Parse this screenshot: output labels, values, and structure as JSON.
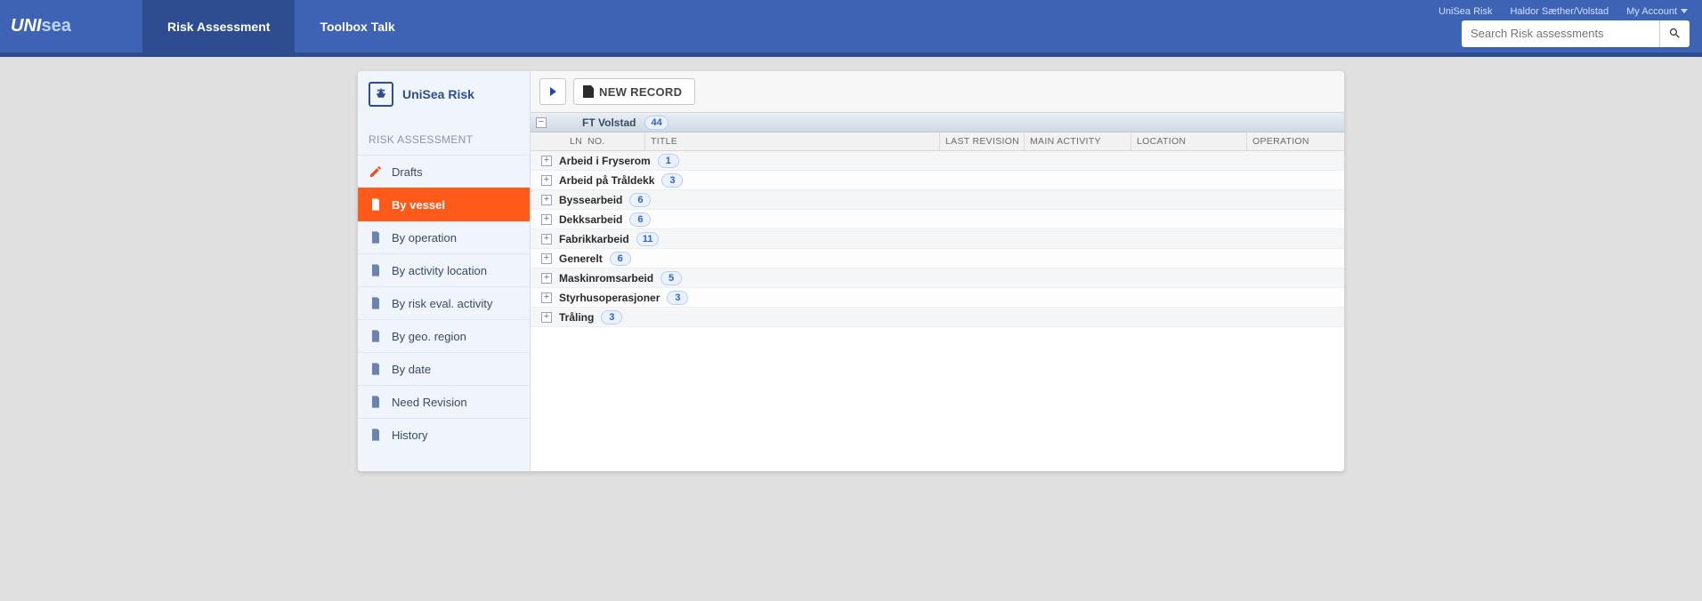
{
  "brand": {
    "a": "UNI",
    "b": "sea"
  },
  "topnav": {
    "tabs": [
      {
        "label": "Risk Assessment",
        "active": true
      },
      {
        "label": "Toolbox Talk",
        "active": false
      }
    ],
    "links": {
      "app": "UniSea Risk",
      "user": "Haldor Sæther/Volstad",
      "account": "My Account"
    },
    "search_placeholder": "Search Risk assessments"
  },
  "sidebar": {
    "module": "UniSea Risk",
    "section": "RISK ASSESSMENT",
    "items": [
      {
        "label": "Drafts",
        "active": false,
        "icon": "edit"
      },
      {
        "label": "By vessel",
        "active": true,
        "icon": "doc"
      },
      {
        "label": "By operation",
        "active": false,
        "icon": "doc"
      },
      {
        "label": "By activity location",
        "active": false,
        "icon": "doc"
      },
      {
        "label": "By risk eval. activity",
        "active": false,
        "icon": "doc"
      },
      {
        "label": "By geo. region",
        "active": false,
        "icon": "doc"
      },
      {
        "label": "By date",
        "active": false,
        "icon": "doc"
      },
      {
        "label": "Need Revision",
        "active": false,
        "icon": "doc"
      },
      {
        "label": "History",
        "active": false,
        "icon": "doc"
      }
    ]
  },
  "toolbar": {
    "new_record": "NEW RECORD"
  },
  "group": {
    "name": "FT Volstad",
    "count": "44"
  },
  "columns": {
    "ln": "LN",
    "no": "NO.",
    "title": "TITLE",
    "last_revision": "LAST REVISION",
    "main_activity": "MAIN ACTIVITY",
    "location": "LOCATION",
    "operation": "OPERATION"
  },
  "rows": [
    {
      "title": "Arbeid i Fryserom",
      "count": "1"
    },
    {
      "title": "Arbeid på Tråldekk",
      "count": "3"
    },
    {
      "title": "Byssearbeid",
      "count": "6"
    },
    {
      "title": "Dekksarbeid",
      "count": "6"
    },
    {
      "title": "Fabrikkarbeid",
      "count": "11"
    },
    {
      "title": "Generelt",
      "count": "6"
    },
    {
      "title": "Maskinromsarbeid",
      "count": "5"
    },
    {
      "title": "Styrhusoperasjoner",
      "count": "3"
    },
    {
      "title": "Tråling",
      "count": "3"
    }
  ]
}
